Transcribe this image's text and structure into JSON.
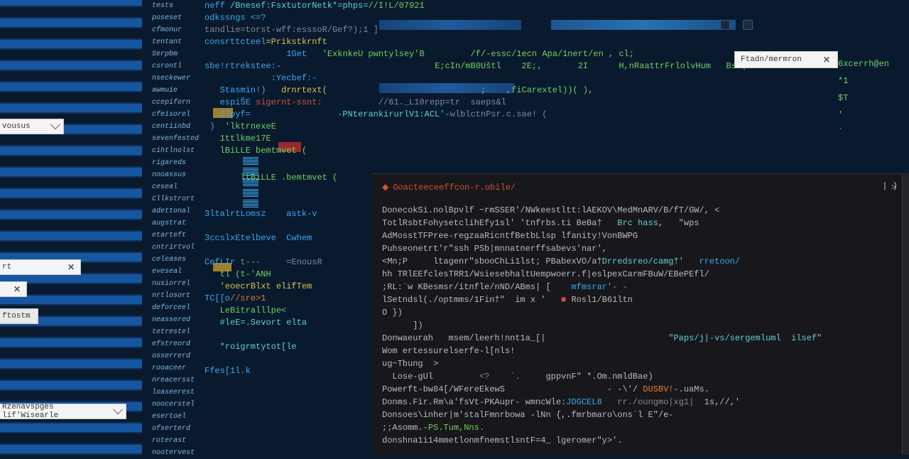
{
  "sidebar": {
    "items": [
      "tests",
      "poseset",
      "cfmonur",
      "tentant",
      "Serpbm",
      "csrontl",
      "nseckewer",
      "awmuie",
      "ccepiforn",
      "cfeisorel",
      "centiinbd",
      "sevenfested",
      "cihtlnolst",
      "rigareds",
      "nooassus",
      "ceseal",
      "Cllkstrort",
      "adettonal",
      "augstrat",
      "etarteft",
      "cntrirtvol",
      "celeases",
      "eveseal",
      "nusiorrel",
      "nrtlosort",
      "deforceel",
      "neassered",
      "tetrestel",
      "efstreord",
      "osserrerd",
      "rooaceer",
      "nreacersst",
      "loaseerest",
      "noocerstel",
      "esertoel",
      "ofserterd",
      "roterast",
      "nootervest"
    ]
  },
  "editor": {
    "lines": [
      [
        {
          "t": "neff",
          "c": "t-blue"
        },
        {
          "t": " /Bnesef:FsxtutorNetk*=phps=",
          "c": "t-cyan"
        },
        {
          "t": "//I!L/07921",
          "c": "t-green"
        }
      ],
      [
        {
          "t": "odkssngs ",
          "c": "t-blue"
        },
        {
          "t": "<=?",
          "c": "t-blue"
        }
      ],
      [
        {
          "t": "tandlie=torst",
          "c": "t-gray"
        },
        {
          "t": "-wff:esssoR",
          "c": "t-gray"
        },
        {
          "t": "/Gef?);1 ]",
          "c": "t-gray"
        }
      ],
      [
        {
          "t": "consrttcteel",
          "c": "t-blue"
        },
        {
          "t": "=Prikstkrnft",
          "c": "t-yellow"
        }
      ],
      [
        {
          "t": "                1Get",
          "c": "t-blue"
        },
        {
          "t": "   'ExknkeU pwntylsey'B",
          "c": "t-green"
        },
        {
          "t": "         /f/-essc/1ecn Apa/1nert/en , cl;",
          "c": "t-green"
        }
      ],
      [
        {
          "t": "sbe!rtrekstee:",
          "c": "t-blue"
        },
        {
          "t": "-                              ",
          "c": ""
        },
        {
          "t": "E;cIn/mB0Uštl    2E;,       2I      H,nRaattrFrlolvHum   Bsk(u",
          "c": "t-green"
        }
      ],
      [
        {
          "t": "             :Yecbef:-",
          "c": "t-blue"
        }
      ],
      [
        {
          "t": "   Stasmin!)",
          "c": "t-blue"
        },
        {
          "t": "   drnrtext(",
          "c": "t-yellow"
        },
        {
          "t": "                              ;    ,fiCarextel))( ),",
          "c": "t-green"
        }
      ],
      [
        {
          "t": "   espiŠE ",
          "c": "t-blue"
        },
        {
          "t": "sigernt-ssnt:",
          "c": "t-red"
        },
        {
          "t": "           //61._L10repp=tr  saeps&l",
          "c": "t-gray"
        }
      ],
      [
        {
          "t": "   Clpyf=",
          "c": "t-blue"
        },
        {
          "t": "                 -PNterankirurlV1:ACL'-",
          "c": "t-cyan"
        },
        {
          "t": "wlblctnPsr.c.sae! (",
          "c": "t-gray"
        }
      ],
      [
        {
          "t": " )",
          "c": "t-blue"
        },
        {
          "t": "  'lktrnexeE",
          "c": "t-green"
        }
      ],
      [
        {
          "t": "   1ttlkme17E",
          "c": "t-green"
        }
      ],
      [
        {
          "t": "   lBiLLE bemtmvet (",
          "c": "t-green"
        }
      ]
    ]
  },
  "before_terminal": {
    "lines": [
      [
        {
          "t": "       ltBiLLE .bemtmvet (",
          "c": "t-green"
        }
      ],
      [
        {
          "t": "",
          "c": ""
        }
      ],
      [
        {
          "t": "       ",
          "c": ""
        }
      ],
      [
        {
          "t": "3ltalrtLomsz    astk-v",
          "c": "t-blue"
        }
      ],
      [
        {
          "t": "",
          "c": ""
        }
      ],
      [
        {
          "t": "3ccslxEtelbeve  Cwhem",
          "c": "t-blue"
        }
      ],
      [
        {
          "t": "",
          "c": ""
        }
      ],
      [
        {
          "t": "CefLIr ",
          "c": "t-blue"
        },
        {
          "t": "t---     =EnousR",
          "c": "t-gray"
        }
      ],
      [
        {
          "t": "   ",
          "c": ""
        },
        {
          "t": "tl (t-'ANH",
          "c": "t-green"
        }
      ],
      [
        {
          "t": "   ",
          "c": ""
        },
        {
          "t": "'eoecrBlxt elifTem",
          "c": "t-yellow"
        }
      ],
      [
        {
          "t": "TC[[o",
          "c": "t-blue"
        },
        {
          "t": "//sre>1",
          "c": "t-orange"
        }
      ],
      [
        {
          "t": "   LeBitralllpe<",
          "c": "t-green"
        }
      ],
      [
        {
          "t": "   #leE=.Sevort elta",
          "c": "t-cyan"
        }
      ],
      [
        {
          "t": "",
          "c": ""
        }
      ],
      [
        {
          "t": "   *roigrmtytot[le",
          "c": "t-cyan"
        }
      ],
      [
        {
          "t": "   ",
          "c": ""
        }
      ],
      [
        {
          "t": "Ffes[1l.k",
          "c": "t-blue"
        }
      ],
      [
        {
          "t": "",
          "c": ""
        }
      ]
    ]
  },
  "right_edge": {
    "lines": [
      "6xcerrh@en",
      "",
      "",
      "",
      "*1",
      "$T",
      "'",
      "",
      "",
      "",
      "`"
    ]
  },
  "terminal": {
    "header": "Goacteeceeffcon-r.obile/",
    "header_caret": ">",
    "close_symbol": "| )",
    "lines": [
      [
        {
          "t": "DonecokSi.nolBpvlf ~rmSSER'/NWkeestltt:lAEKOV\\MedMnARV/B/fT/GW/, <",
          "c": ""
        }
      ],
      [
        {
          "t": "TotlRsbtFohysetclihEfy1sl' 'tnfrbs.ti BeBa†   ",
          "c": ""
        },
        {
          "t": "Brc hass",
          "c": "t-cyan"
        },
        {
          "t": ",   \"wps ",
          "c": ""
        }
      ],
      [
        {
          "t": "AdMosstTFPree-regzaaRicntfBetbLlsp lfanity!VonBWPG",
          "c": ""
        }
      ],
      [
        {
          "t": "Puhseonetrt'r\"ssh PSb|mnnatnerffsabevs'nar',",
          "c": ""
        }
      ],
      [
        {
          "t": "<Mn;P     ltagenr\"sbooChLi1lst; PBabexVO/a†",
          "c": ""
        },
        {
          "t": "Drredsreo/camg†'",
          "c": "t-cyan"
        },
        {
          "t": "   rretoon/",
          "c": "t-blue"
        }
      ],
      [
        {
          "t": "hh TRlEEfclesTRR1/WsiesebhaltUempwoerr.f|eslpexCarmFBuW/EBePEfl/",
          "c": ""
        }
      ],
      [
        {
          "t": ";RL:`w KBesmsr/itnfle/nND/ABms| [    ",
          "c": ""
        },
        {
          "t": "mfmsrar'- -",
          "c": "t-blue"
        }
      ],
      [
        {
          "t": "lSetndsl(./optmms/1Fin†\"  im x '   ",
          "c": ""
        },
        {
          "t": "■ ",
          "c": "t-red"
        },
        {
          "t": "Rosl1/B61ltn",
          "c": ""
        }
      ],
      [
        {
          "t": "O })",
          "c": ""
        }
      ],
      [
        {
          "t": "      ])",
          "c": ""
        }
      ],
      [
        {
          "t": "Donwaeurah   msem/leerh!nnt1a_[|                        ",
          "c": ""
        },
        {
          "t": "\"Paps/j|-vs/sergemluml  ilsef\"",
          "c": "t-cyan"
        }
      ],
      [
        {
          "t": "Wom ertessurelserfe-l[nls!",
          "c": ""
        }
      ],
      [
        {
          "t": "ug~Tbung  >",
          "c": ""
        }
      ],
      [
        {
          "t": "  Lose-gUl         ",
          "c": ""
        },
        {
          "t": "<?    `.     ",
          "c": "t-gray"
        },
        {
          "t": "gppvnF\" *.Om.nmldBae)",
          "c": ""
        }
      ],
      [
        {
          "t": "Powerft-bw84[/WFereEkewS                    - -\\'/ ",
          "c": ""
        },
        {
          "t": "DUSBV!",
          "c": "t-orange"
        },
        {
          "t": "-.uaMs.",
          "c": ""
        }
      ],
      [
        {
          "t": "Donms.Fir.Rm\\a'fsVt-PKAupr- wmncWle:",
          "c": ""
        },
        {
          "t": "JDGCEL8",
          "c": "t-blue"
        },
        {
          "t": "   rr./oungmo|xg1|",
          "c": "t-gray"
        },
        {
          "t": "  1s,//,'",
          "c": ""
        }
      ],
      [
        {
          "t": "Donsoes\\inher|m'stalFmnrbowa -lNn {,.fmrbmaro\\ons`l E\"/e-",
          "c": ""
        }
      ],
      [
        {
          "t": ";;Asomm.-",
          "c": ""
        },
        {
          "t": "PS.Tum,Nns.",
          "c": "t-green"
        }
      ],
      [
        {
          "t": "donshna1i14mmetlonmfnemstlsntF=4_ lgeromer\"y>'.",
          "c": ""
        }
      ]
    ]
  },
  "popups": {
    "dropdown_left": "vousus",
    "popup_small1": "rt",
    "popup_small2": "",
    "popup_timer": "ftostm",
    "dropdown_bottom": "Rzenavspges lif'Wisearle",
    "find": "Ftadn/mermron"
  }
}
